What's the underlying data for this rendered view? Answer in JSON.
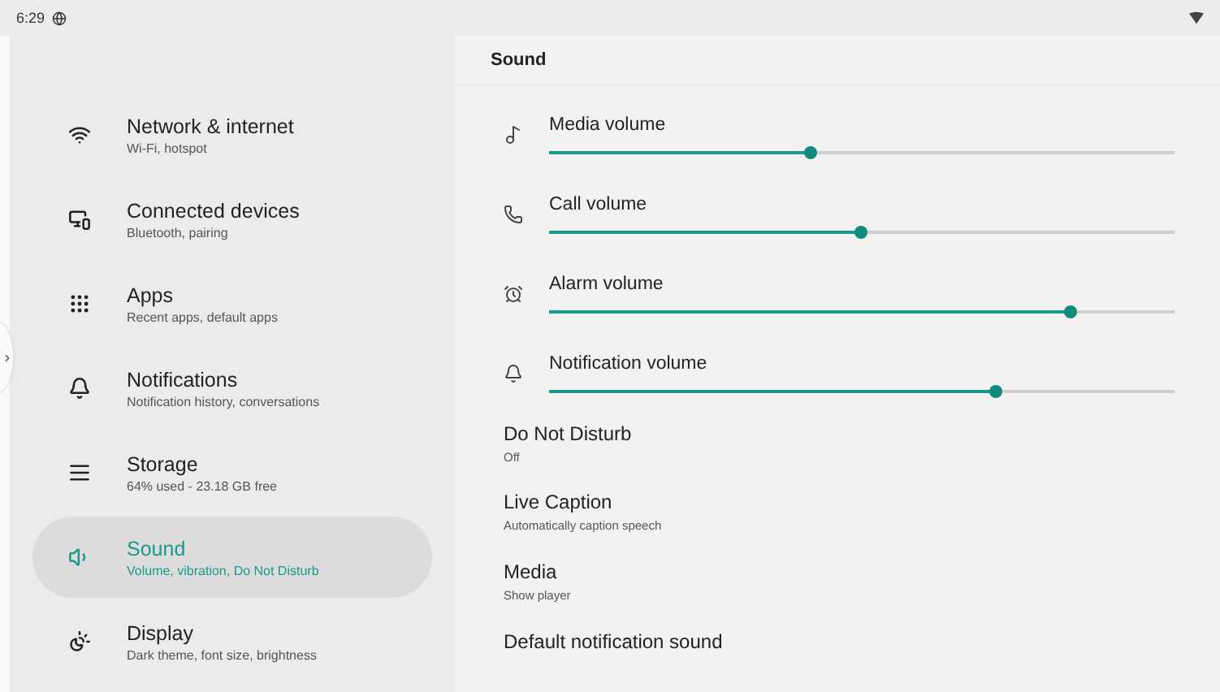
{
  "status_bar": {
    "time": "6:29"
  },
  "sidebar": {
    "items": [
      {
        "title": "Network & internet",
        "summary": "Wi-Fi, hotspot",
        "selected": false
      },
      {
        "title": "Connected devices",
        "summary": "Bluetooth, pairing",
        "selected": false
      },
      {
        "title": "Apps",
        "summary": "Recent apps, default apps",
        "selected": false
      },
      {
        "title": "Notifications",
        "summary": "Notification history, conversations",
        "selected": false
      },
      {
        "title": "Storage",
        "summary": "64% used - 23.18 GB free",
        "selected": false
      },
      {
        "title": "Sound",
        "summary": "Volume, vibration, Do Not Disturb",
        "selected": true
      },
      {
        "title": "Display",
        "summary": "Dark theme, font size, brightness",
        "selected": false
      }
    ]
  },
  "page": {
    "title": "Sound",
    "sliders": [
      {
        "label": "Media volume",
        "level": 0.418
      },
      {
        "label": "Call volume",
        "level": 0.499
      },
      {
        "label": "Alarm volume",
        "level": 0.833
      },
      {
        "label": "Notification volume",
        "level": 0.713
      }
    ],
    "rows": [
      {
        "title": "Do Not Disturb",
        "summary": "Off"
      },
      {
        "title": "Live Caption",
        "summary": "Automatically caption speech"
      },
      {
        "title": "Media",
        "summary": "Show player"
      },
      {
        "title": "Default notification sound"
      }
    ]
  }
}
